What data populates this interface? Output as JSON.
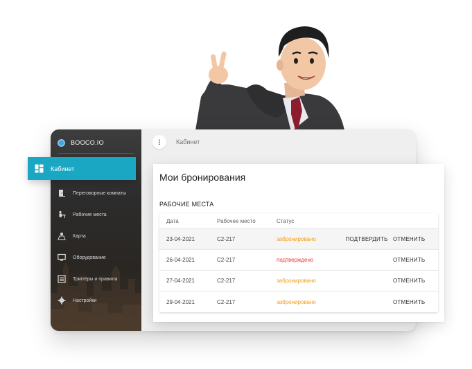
{
  "app": {
    "brand": "BOOCO.IO",
    "breadcrumb": "Кабинет"
  },
  "sidebar": {
    "active_item": {
      "label": "Кабинет",
      "icon": "dashboard-icon"
    },
    "items": [
      {
        "label": "Переговорные комнаты",
        "icon": "door-icon"
      },
      {
        "label": "Рабочие места",
        "icon": "desk-icon"
      },
      {
        "label": "Карта",
        "icon": "map-icon"
      },
      {
        "label": "Оборудование",
        "icon": "monitor-icon"
      },
      {
        "label": "Триггеры и правила",
        "icon": "rules-icon"
      },
      {
        "label": "Настройки",
        "icon": "gear-icon"
      }
    ]
  },
  "bookings": {
    "title": "Мои бронирования",
    "section": "РАБОЧИЕ МЕСТА",
    "columns": [
      "Дата",
      "Рабочее место",
      "Статус"
    ],
    "rows": [
      {
        "date": "23-04-2021",
        "place": "C2-217",
        "status": "забронировано",
        "confirm": "ПОДТВЕРДИТЬ",
        "cancel": "ОТМЕНИТЬ"
      },
      {
        "date": "26-04-2021",
        "place": "C2-217",
        "status": "подтверждено",
        "confirm": "",
        "cancel": "ОТМЕНИТЬ"
      },
      {
        "date": "27-04-2021",
        "place": "C2-217",
        "status": "забронировано",
        "confirm": "",
        "cancel": "ОТМЕНИТЬ"
      },
      {
        "date": "29-04-2021",
        "place": "C2-217",
        "status": "забронировано",
        "confirm": "",
        "cancel": "ОТМЕНИТЬ"
      }
    ]
  },
  "colors": {
    "accent": "#1aa7c3",
    "booked": "#f39c12",
    "confirmed": "#e53935"
  }
}
